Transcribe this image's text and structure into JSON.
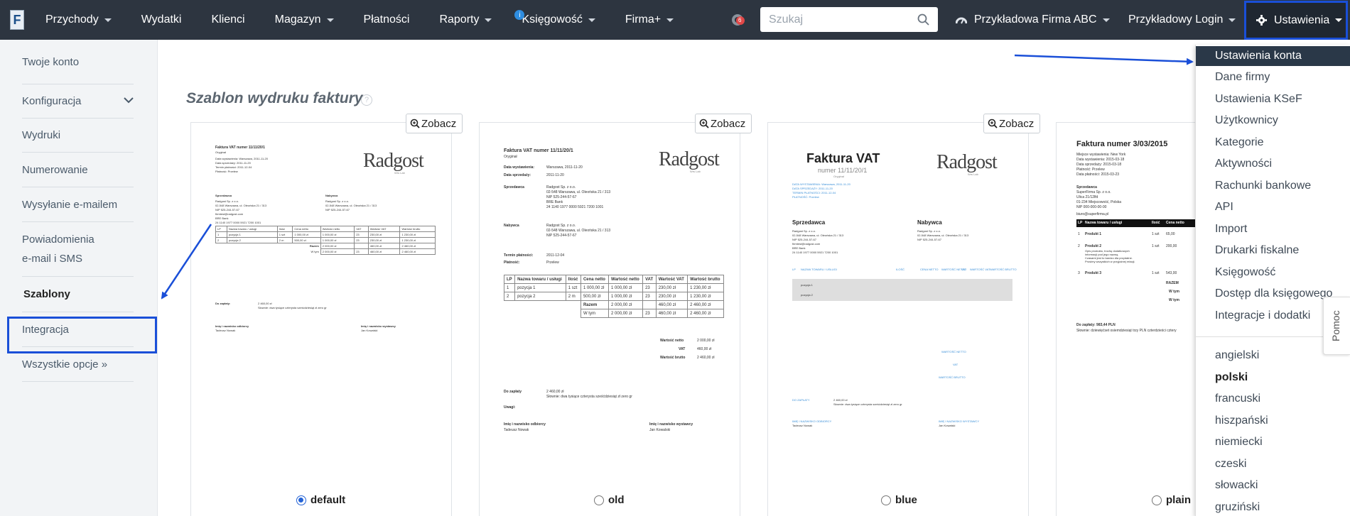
{
  "topbar": {
    "logo": "F",
    "nav": [
      {
        "label": "Przychody",
        "caret": true
      },
      {
        "label": "Wydatki",
        "caret": false
      },
      {
        "label": "Klienci",
        "caret": false
      },
      {
        "label": "Magazyn",
        "caret": true
      },
      {
        "label": "Płatności",
        "caret": false
      },
      {
        "label": "Raporty",
        "caret": true
      },
      {
        "label": "Księgowość",
        "caret": true,
        "badge": "i"
      },
      {
        "label": "Firma+",
        "caret": true
      }
    ],
    "notification_count": "6",
    "search_placeholder": "Szukaj",
    "company": "Przykładowa Firma ABC",
    "login": "Przykładowy Login",
    "settings": "Ustawienia"
  },
  "sidebar": {
    "items": [
      "Twoje konto",
      "Konfiguracja",
      "Wydruki",
      "Numerowanie",
      "Wysyłanie e-mailem",
      "Powiadomienia",
      "e-mail i SMS",
      "Szablony",
      "Integracja",
      "Wszystkie opcje »"
    ]
  },
  "main": {
    "title": "Szablon wydruku faktury",
    "help": "?",
    "view_label": "Zobacz",
    "templates": [
      {
        "name": "default",
        "selected": true
      },
      {
        "name": "old",
        "selected": false
      },
      {
        "name": "blue",
        "selected": false
      },
      {
        "name": "plain",
        "selected": false
      }
    ]
  },
  "previews": {
    "logo": "Radgost",
    "logo_sub": "Wrs Lab",
    "p1": {
      "title": "Faktura VAT numer 11/11/20/1",
      "lines": [
        "Oryginał",
        "Data wystawienia: Warszawa, 2011-11-20",
        "Data sprzedaży: 2011-11-20",
        "Termin płatności: 2011-12-04",
        "Płatność: Przelew"
      ],
      "seller_h": "Sprzedawca",
      "buyer_h": "Nabywca",
      "seller": [
        "Radgost Sp. z o.o.",
        "02-548 Warszawa, ul. Oleońska 21 / 313",
        "NIP 525-244-57-67",
        "firmtest@radgost.com",
        "BRE Bank",
        "24 1140 1977 0000 5921 7200 1001"
      ],
      "buyer": [
        "Radgost Sp. z o.o.",
        "02-548 Warszawa, ul. Oleońska 21 / 313",
        "NIP 525-244-57-67"
      ],
      "pay": [
        "Do zapłaty:",
        "2 460,00 zł",
        "Słownie: dwa tysiące czterysta sześćdziesiąt zł zero gr"
      ],
      "sign": [
        "Imię i nazwisko odbiorcy",
        "Tadeusz Nowak",
        "Imię i nazwisko wystawcy",
        "Jan Kowalski"
      ]
    },
    "p2": {
      "title": "Faktura VAT numer 11/11/20/1",
      "lines": [
        "Oryginał",
        "Data wystawienia:",
        "Warszawa, 2011-11-20",
        "Data sprzedaży:",
        "2011-11-20"
      ],
      "seller_h": "Sprzedawca",
      "seller": [
        "Radgost Sp. z o.o.",
        "02-548 Warszawa, ul. Oleońska 21 / 313",
        "NIP 525-244-57-67",
        "BRE Bank",
        "24 1140 1977 0000 5921 7200 1001"
      ],
      "buyer_h": "Nabywca",
      "buyer": [
        "Radgost Sp. z o.o.",
        "02-548 Warszawa, ul. Oleońska 21 / 313",
        "NIP 525-244-57-67"
      ],
      "term": [
        "Termin płatności:",
        "2011-12-04",
        "Płatność:",
        "Przelew"
      ],
      "cols": [
        "LP",
        "Nazwa towaru / usługi",
        "Ilość",
        "Cena netto",
        "Wartość netto",
        "VAT",
        "Wartość VAT",
        "Wartość brutto"
      ],
      "rows": [
        [
          "1",
          "pozycja 1",
          "1 szt",
          "1 000,00 zł",
          "1 000,00 zł",
          "23",
          "230,00 zł",
          "1 230,00 zł"
        ],
        [
          "2",
          "pozycja 2",
          "2 m",
          "500,00 zł",
          "1 000,00 zł",
          "23",
          "230,00 zł",
          "1 230,00 zł"
        ]
      ],
      "sum": [
        [
          "Razem",
          "2 000,00 zł",
          "",
          "460,00 zł",
          "2 460,00 zł"
        ],
        [
          "W tym",
          "2 000,00 zł",
          "23",
          "460,00 zł",
          "2 460,00 zł"
        ]
      ],
      "totals": [
        [
          "Wartość netto",
          "2 000,00 zł"
        ],
        [
          "VAT",
          "460,00 zł"
        ],
        [
          "Wartość brutto",
          "2 460,00 zł"
        ]
      ],
      "pay": [
        "Do zapłaty",
        "2 460,00 zł",
        "Słownie: dwa tysiące czterysta sześćdziesiąt zł zero gr",
        "Uwagi:"
      ],
      "sign": [
        "Imię i nazwisko odbiorcy",
        "Tadeusz Nowak",
        "Imię i nazwisko wystawcy",
        "Jan Kowalski"
      ]
    },
    "p3": {
      "title": "Faktura VAT",
      "number": "numer 11/11/20/1",
      "orig": "Oryginał",
      "lines": [
        "DATA WYSTAWIENIA: Warszawa, 2011-11-20",
        "DATA SPRZEDAŻY: 2011-11-20",
        "TERMIN PŁATNOŚCI: 2011-12-04",
        "PŁATNOŚĆ: Przelew"
      ],
      "seller_h": "Sprzedawca",
      "buyer_h": "Nabywca",
      "seller": [
        "Radgost Sp. z o.o.",
        "02-548 Warszawa, ul. Oleońska 21 / 313",
        "NIP 525-244-57-67",
        "firmtest@radgost.com",
        "BRE Bank",
        "24 1140 1977 0000 5921 7200 1001"
      ],
      "buyer": [
        "Radgost Sp. z o.o.",
        "02-548 Warszawa, ul. Oleońska 21 / 313",
        "NIP 525-244-57-67"
      ],
      "cols": [
        "LP",
        "NAZWA TOWARU / USŁUGI",
        "ILOŚĆ",
        "CENA NETTO",
        "WARTOŚĆ NETTO",
        "VAT",
        "WARTOŚĆ VAT",
        "WARTOŚĆ BRUTTO"
      ],
      "rows": [
        "pozycja 1",
        "pozycja 2"
      ],
      "totals": [
        "WARTOŚĆ NETTO",
        "VAT",
        "WARTOŚĆ BRUTTO"
      ],
      "pay": [
        "DO ZAPŁATY",
        "2 460,00 zł",
        "Słownie: dwa tysiące czterysta sześćdziesiąt zł zero gr"
      ],
      "sign": [
        "IMIĘ I NAZWISKO ODBIORCY",
        "Tadeusz Nowak",
        "IMIĘ I NAZWISKO WYSTAWCY",
        "Jan Kowalski"
      ]
    },
    "p4": {
      "title": "Faktura numer 3/03/2015",
      "lines": [
        "Miejsce wystawienia: New York",
        "Data wystawienia: 2015-03-18",
        "Data sprzedaży: 2015-03-18",
        "Płatność: Przelew",
        "Data płatności: 2015-03-23"
      ],
      "seller_h": "Sprzedawca",
      "seller": [
        "SuperFirma Sp. z o.o.",
        "Ulica 21/12lfd",
        "01-234 Miejscowość, Polska",
        "NIP 000-000-00-00",
        "biuro@superfirma.pl"
      ],
      "cols": [
        "LP",
        "Nazwa towaru / usługi",
        "Ilość",
        "Cena netto"
      ],
      "rows": [
        [
          "1",
          "Produkt 1",
          "1 szt",
          "65,00"
        ],
        [
          "2",
          "Produkt 2",
          "1 szt",
          "200,00"
        ],
        [
          "3",
          "Produkt 3",
          "1 szt",
          "543,00"
        ]
      ],
      "row2_desc": [
        "Opis produktu, trochę dodatkowych",
        "informacji pod jego nazwą.",
        "Czasami jest to bardzo dla przydatne.",
        "Prosimy wszystkich w przyjaźnej relacji."
      ],
      "sum": [
        "RAZEM",
        "W tym",
        "W tym"
      ],
      "pay": [
        "Do zapłaty: 983,44 PLN",
        "Słownie: dziewięćset osiemdziesiąt trzy PLN czterdzieści cztery"
      ]
    }
  },
  "dropdown": {
    "items": [
      "Ustawienia konta",
      "Dane firmy",
      "Ustawienia KSeF",
      "Użytkownicy",
      "Kategorie",
      "Aktywności",
      "Rachunki bankowe",
      "API",
      "Import",
      "Drukarki fiskalne",
      "Księgowość",
      "Dostęp dla księgowego",
      "Integracje i dodatki"
    ],
    "languages": [
      "angielski",
      "polski",
      "francuski",
      "hiszpański",
      "niemiecki",
      "czeski",
      "słowacki",
      "gruziński"
    ],
    "selected_language": "polski"
  },
  "help_tab": "Pomoc",
  "colors": {
    "topbar": "#2d3540",
    "highlight": "#1a4fd8",
    "dropdown_active": "#2a3848",
    "blue_template_accent": "#3a8fd8"
  }
}
